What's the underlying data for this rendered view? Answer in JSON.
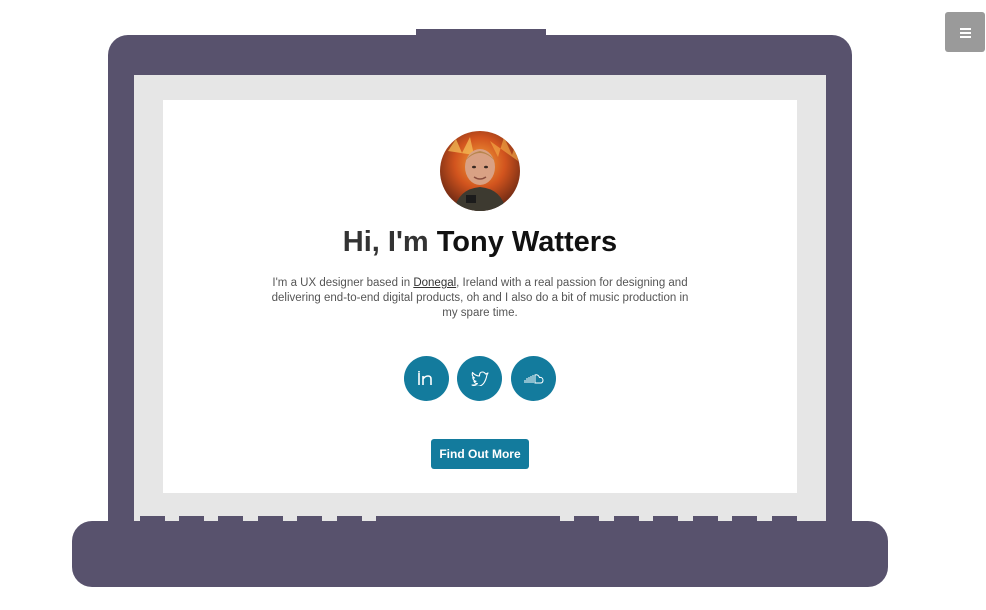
{
  "nav": {
    "menu_icon": "hamburger-icon"
  },
  "hero": {
    "greeting": "Hi, I'm",
    "name": "Tony Watters",
    "bio_before_link": "I'm a UX designer based in ",
    "bio_link": "Donegal",
    "bio_after_link": ", Ireland with a real passion for designing and delivering end-to-end digital products, oh and I also do a bit of music production in my spare time.",
    "cta_label": "Find Out More"
  },
  "social": [
    {
      "icon": "linkedin-icon"
    },
    {
      "icon": "twitter-icon"
    },
    {
      "icon": "soundcloud-icon"
    }
  ],
  "colors": {
    "laptop": "#58526d",
    "accent": "#137b9d",
    "bezel": "#e6e6e6",
    "menu_button": "#9a9a9a"
  }
}
